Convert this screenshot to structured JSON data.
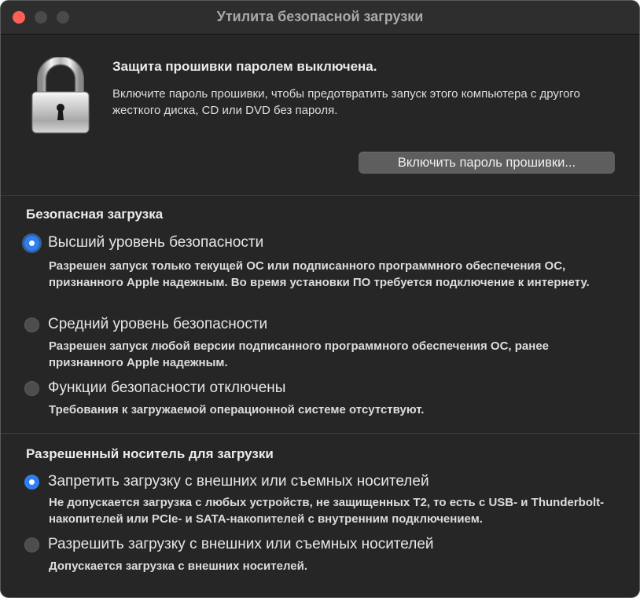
{
  "window": {
    "title": "Утилита безопасной загрузки"
  },
  "firmware": {
    "status_title": "Защита прошивки паролем выключена.",
    "description": "Включите пароль прошивки, чтобы предотвратить запуск этого компьютера с другого жесткого диска, CD или DVD без пароля.",
    "button_label": "Включить пароль прошивки...",
    "icon": "padlock-icon"
  },
  "secure_boot": {
    "heading": "Безопасная загрузка",
    "options": [
      {
        "label": "Высший уровень безопасности",
        "description": "Разрешен запуск только текущей ОС или подписанного программного обеспечения ОС, признанного Apple надежным. Во время установки ПО требуется подключение к интернету.",
        "selected": true
      },
      {
        "label": "Средний уровень безопасности",
        "description": "Разрешен запуск любой версии подписанного программного обеспечения ОС, ранее признанного Apple надежным.",
        "selected": false
      },
      {
        "label": "Функции безопасности отключены",
        "description": "Требования к загружаемой операционной системе отсутствуют.",
        "selected": false
      }
    ]
  },
  "boot_media": {
    "heading": "Разрешенный носитель для загрузки",
    "options": [
      {
        "label": "Запретить загрузку с внешних или съемных носителей",
        "description": "Не допускается загрузка с любых устройств, не защищенных T2, то есть с USB- и Thunderbolt-накопителей или PCIe- и SATA-накопителей с внутренним подключением.",
        "selected": true
      },
      {
        "label": "Разрешить загрузку с внешних или съемных носителей",
        "description": "Допускается загрузка с внешних носителей.",
        "selected": false
      }
    ]
  },
  "colors": {
    "window_bg": "#262626",
    "accent": "#2f7ff4",
    "close_button": "#ff5f57",
    "button_bg": "#5e5e5e"
  }
}
